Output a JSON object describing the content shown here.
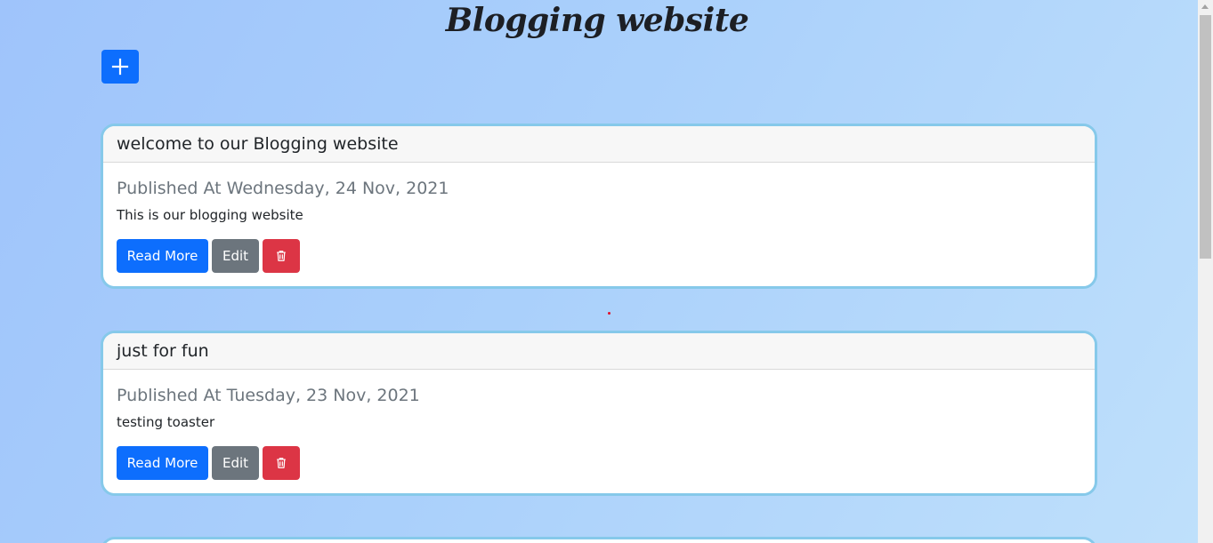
{
  "site": {
    "title": "Blogging website"
  },
  "toolbar": {
    "add_icon": "plus-icon",
    "accent_color": "#0d6efd"
  },
  "posts": [
    {
      "title": "welcome to our Blogging website",
      "published": "Published At Wednesday, 24 Nov, 2021",
      "description": "This is our blogging website",
      "read_more_label": "Read More",
      "edit_label": "Edit",
      "delete_icon": "trash-icon"
    },
    {
      "title": "just for fun",
      "published": "Published At Tuesday, 23 Nov, 2021",
      "description": "testing toaster",
      "read_more_label": "Read More",
      "edit_label": "Edit",
      "delete_icon": "trash-icon"
    }
  ],
  "colors": {
    "primary": "#0d6efd",
    "secondary": "#6c757d",
    "danger": "#dc3545",
    "card_border": "#86c9ea"
  }
}
